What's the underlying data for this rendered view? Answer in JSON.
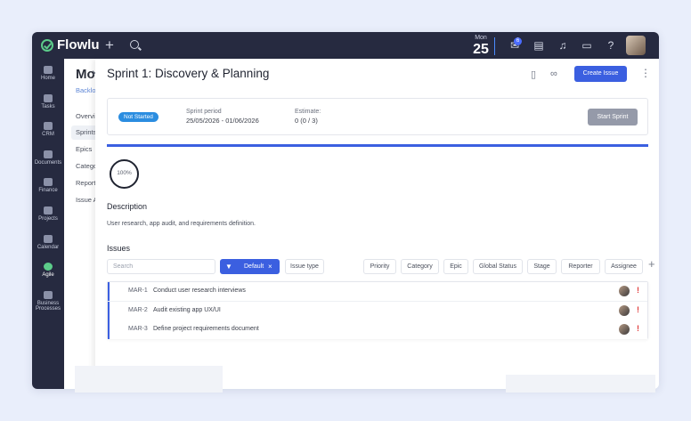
{
  "app": {
    "name": "Flowlu"
  },
  "topbar": {
    "date_dow": "Mon",
    "date_day": "25",
    "notifications_count": "6",
    "icons": [
      "plus-icon",
      "search-icon",
      "inbox-icon",
      "notes-icon",
      "bell-icon",
      "chat-icon",
      "help-icon"
    ]
  },
  "sidebar": {
    "items": [
      {
        "label": "Home",
        "icon": "home-icon"
      },
      {
        "label": "Tasks",
        "icon": "tasks-icon"
      },
      {
        "label": "CRM",
        "icon": "crm-icon"
      },
      {
        "label": "Documents",
        "icon": "documents-icon"
      },
      {
        "label": "Finance",
        "icon": "finance-icon"
      },
      {
        "label": "Projects",
        "icon": "projects-icon"
      },
      {
        "label": "Calendar",
        "icon": "calendar-icon"
      },
      {
        "label": "Agile",
        "icon": "agile-icon"
      },
      {
        "label": "Business Processes",
        "icon": "business-processes-icon"
      }
    ]
  },
  "subpanel": {
    "title": "Mo",
    "crumb": "Backlo",
    "items": [
      "Overvi",
      "Sprints",
      "Epics",
      "Catego",
      "Report",
      "Issue A"
    ]
  },
  "main": {
    "title": "Sprint 1: Discovery & Planning",
    "create_label": "Create Issue",
    "status": "Not Started",
    "period_label": "Sprint period",
    "period_value": "25/05/2026   -  01/06/2026",
    "estimate_label": "Estimate:",
    "estimate_value": "0  (0 / 3)",
    "start_label": "Start Sprint",
    "progress_fraction": 1.0,
    "progress_text": "100%",
    "description_heading": "Description",
    "description_text": "User research, app audit, and requirements definition.",
    "issues_heading": "Issues",
    "search_placeholder": "Search",
    "default_filter": "Default",
    "filters": [
      "Issue type",
      "Priority",
      "Category",
      "Epic",
      "Global Status",
      "Stage",
      "Reporter",
      "Assignee"
    ],
    "issues": [
      {
        "key": "MAR-1",
        "title": "Conduct user research interviews"
      },
      {
        "key": "MAR-2",
        "title": "Audit existing app UX/UI"
      },
      {
        "key": "MAR-3",
        "title": "Define project requirements document"
      }
    ]
  },
  "colors": {
    "topbar": "#262a40",
    "accent": "#3b5fe0",
    "status_pill": "#2b8de0",
    "priority": "#e03b3b",
    "brand_green": "#5ccc8a"
  }
}
